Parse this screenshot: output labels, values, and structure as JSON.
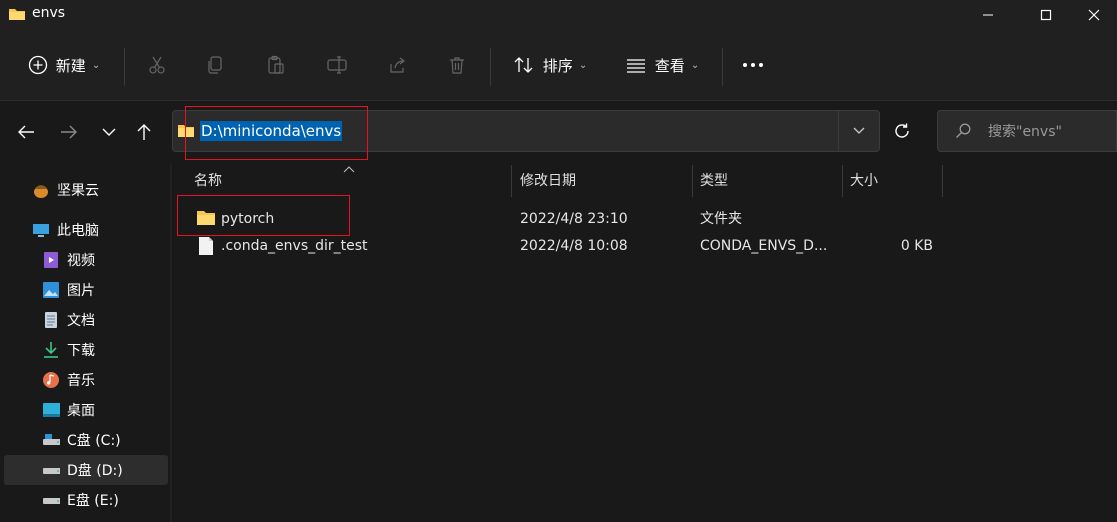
{
  "window": {
    "title": "envs"
  },
  "toolbar": {
    "new_label": "新建",
    "sort_label": "排序",
    "view_label": "查看",
    "more_label": "···"
  },
  "address": {
    "path": "D:\\miniconda\\envs"
  },
  "search": {
    "placeholder": "搜索\"envs\""
  },
  "sidebar": {
    "items": [
      {
        "label": "坚果云",
        "icon": "nutstore-icon"
      },
      {
        "label": "此电脑",
        "icon": "computer-icon"
      },
      {
        "label": "视频",
        "icon": "video-icon"
      },
      {
        "label": "图片",
        "icon": "picture-icon"
      },
      {
        "label": "文档",
        "icon": "document-icon"
      },
      {
        "label": "下载",
        "icon": "download-icon"
      },
      {
        "label": "音乐",
        "icon": "music-icon"
      },
      {
        "label": "桌面",
        "icon": "desktop-icon"
      },
      {
        "label": "C盘 (C:)",
        "icon": "drive-icon"
      },
      {
        "label": "D盘 (D:)",
        "icon": "drive-icon"
      },
      {
        "label": "E盘 (E:)",
        "icon": "drive-icon"
      }
    ]
  },
  "columns": {
    "name": "名称",
    "modified": "修改日期",
    "type": "类型",
    "size": "大小"
  },
  "files": [
    {
      "name": "pytorch",
      "modified": "2022/4/8 23:10",
      "type": "文件夹",
      "size": "",
      "icon": "folder-icon"
    },
    {
      "name": ".conda_envs_dir_test",
      "modified": "2022/4/8 10:08",
      "type": "CONDA_ENVS_D...",
      "size": "0 KB",
      "icon": "file-icon"
    }
  ],
  "colors": {
    "background": "#191919",
    "chrome": "#202020",
    "selection": "#0063b1",
    "highlight_box": "#e81123",
    "folder": "#f8c64a"
  }
}
